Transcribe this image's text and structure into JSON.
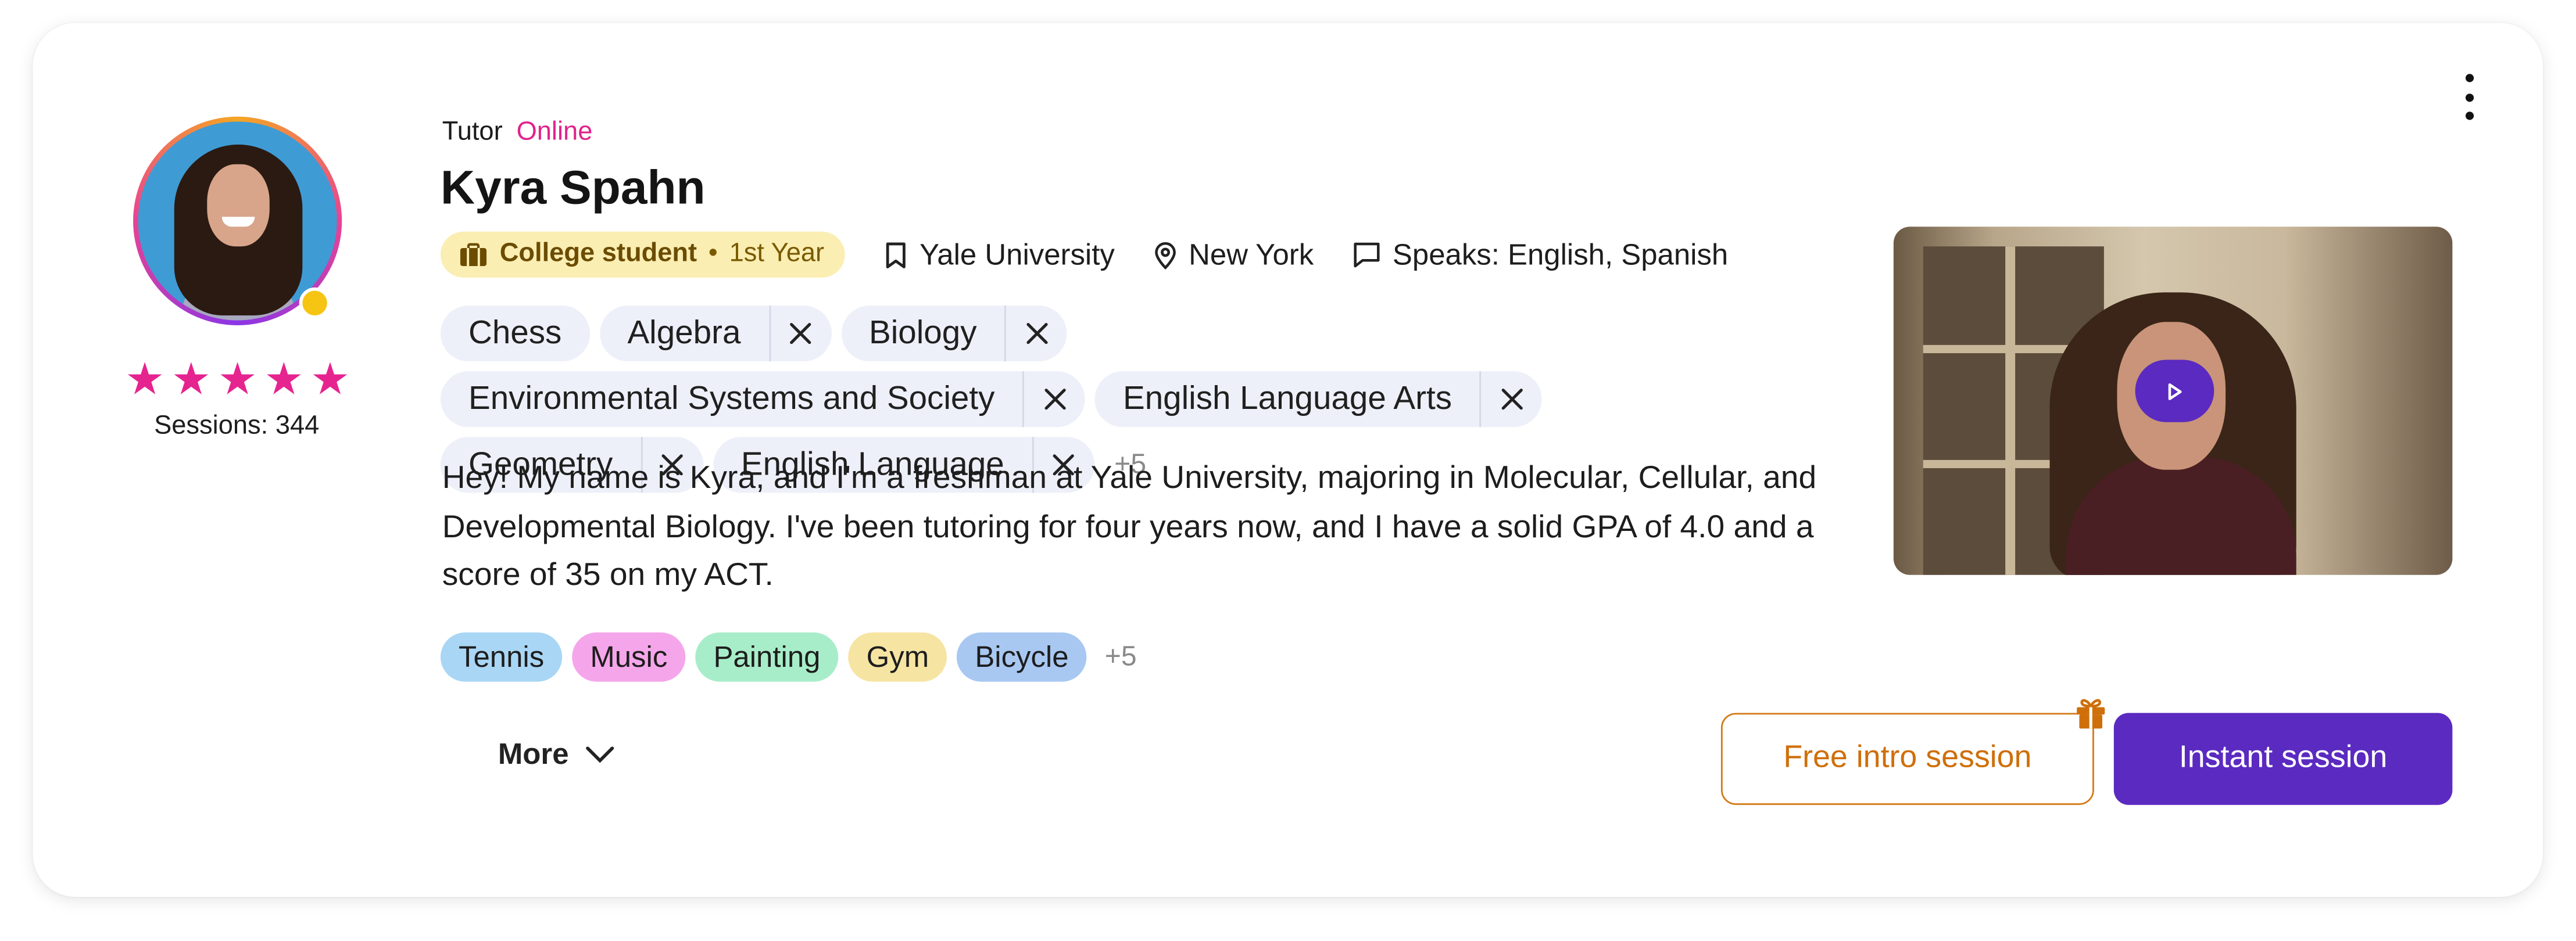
{
  "tutor": {
    "role": "Tutor",
    "status": "Online",
    "name": "Kyra Spahn",
    "rating_stars": 5,
    "sessions": "Sessions: 344",
    "education": {
      "type": "College student",
      "year": "1st Year"
    },
    "university": "Yale University",
    "location": "New York",
    "languages": "Speaks: English, Spanish",
    "bio": "Hey! My name is Kyra, and I'm a freshman at Yale University, majoring in Molecular, Cellular, and Developmental Biology. I've been tutoring for four years now, and I have a solid GPA of 4.0 and a score of 35 on my ACT."
  },
  "subjects": {
    "items": [
      {
        "label": "Chess",
        "removable": false
      },
      {
        "label": "Algebra",
        "removable": true
      },
      {
        "label": "Biology",
        "removable": true
      },
      {
        "label": "Environmental Systems and Society",
        "removable": true
      },
      {
        "label": "English Language Arts",
        "removable": true
      },
      {
        "label": "Geometry",
        "removable": true
      },
      {
        "label": "English Language",
        "removable": true
      }
    ],
    "more": "+5"
  },
  "hobbies": {
    "items": [
      {
        "label": "Tennis",
        "color": "#a9d6f5"
      },
      {
        "label": "Music",
        "color": "#f5a6ea"
      },
      {
        "label": "Painting",
        "color": "#a8edc9"
      },
      {
        "label": "Gym",
        "color": "#f6e4a2"
      },
      {
        "label": "Bicycle",
        "color": "#a8c8f2"
      }
    ],
    "more": "+5"
  },
  "actions": {
    "more": "More",
    "free_intro": "Free intro session",
    "instant": "Instant session"
  },
  "icons": {
    "menu": "kebab-icon",
    "education": "briefcase-icon",
    "university": "bookmark-icon",
    "location": "pin-icon",
    "languages": "chat-icon",
    "remove": "close-icon",
    "play": "play-icon",
    "gift": "gift-icon",
    "chevron": "chevron-down-icon"
  },
  "colors": {
    "accent_purple": "#5b2ac0",
    "online_pink": "#e0238c",
    "star_pink": "#e6248f",
    "orange": "#cf6f0a",
    "status_dot": "#f6c413"
  }
}
